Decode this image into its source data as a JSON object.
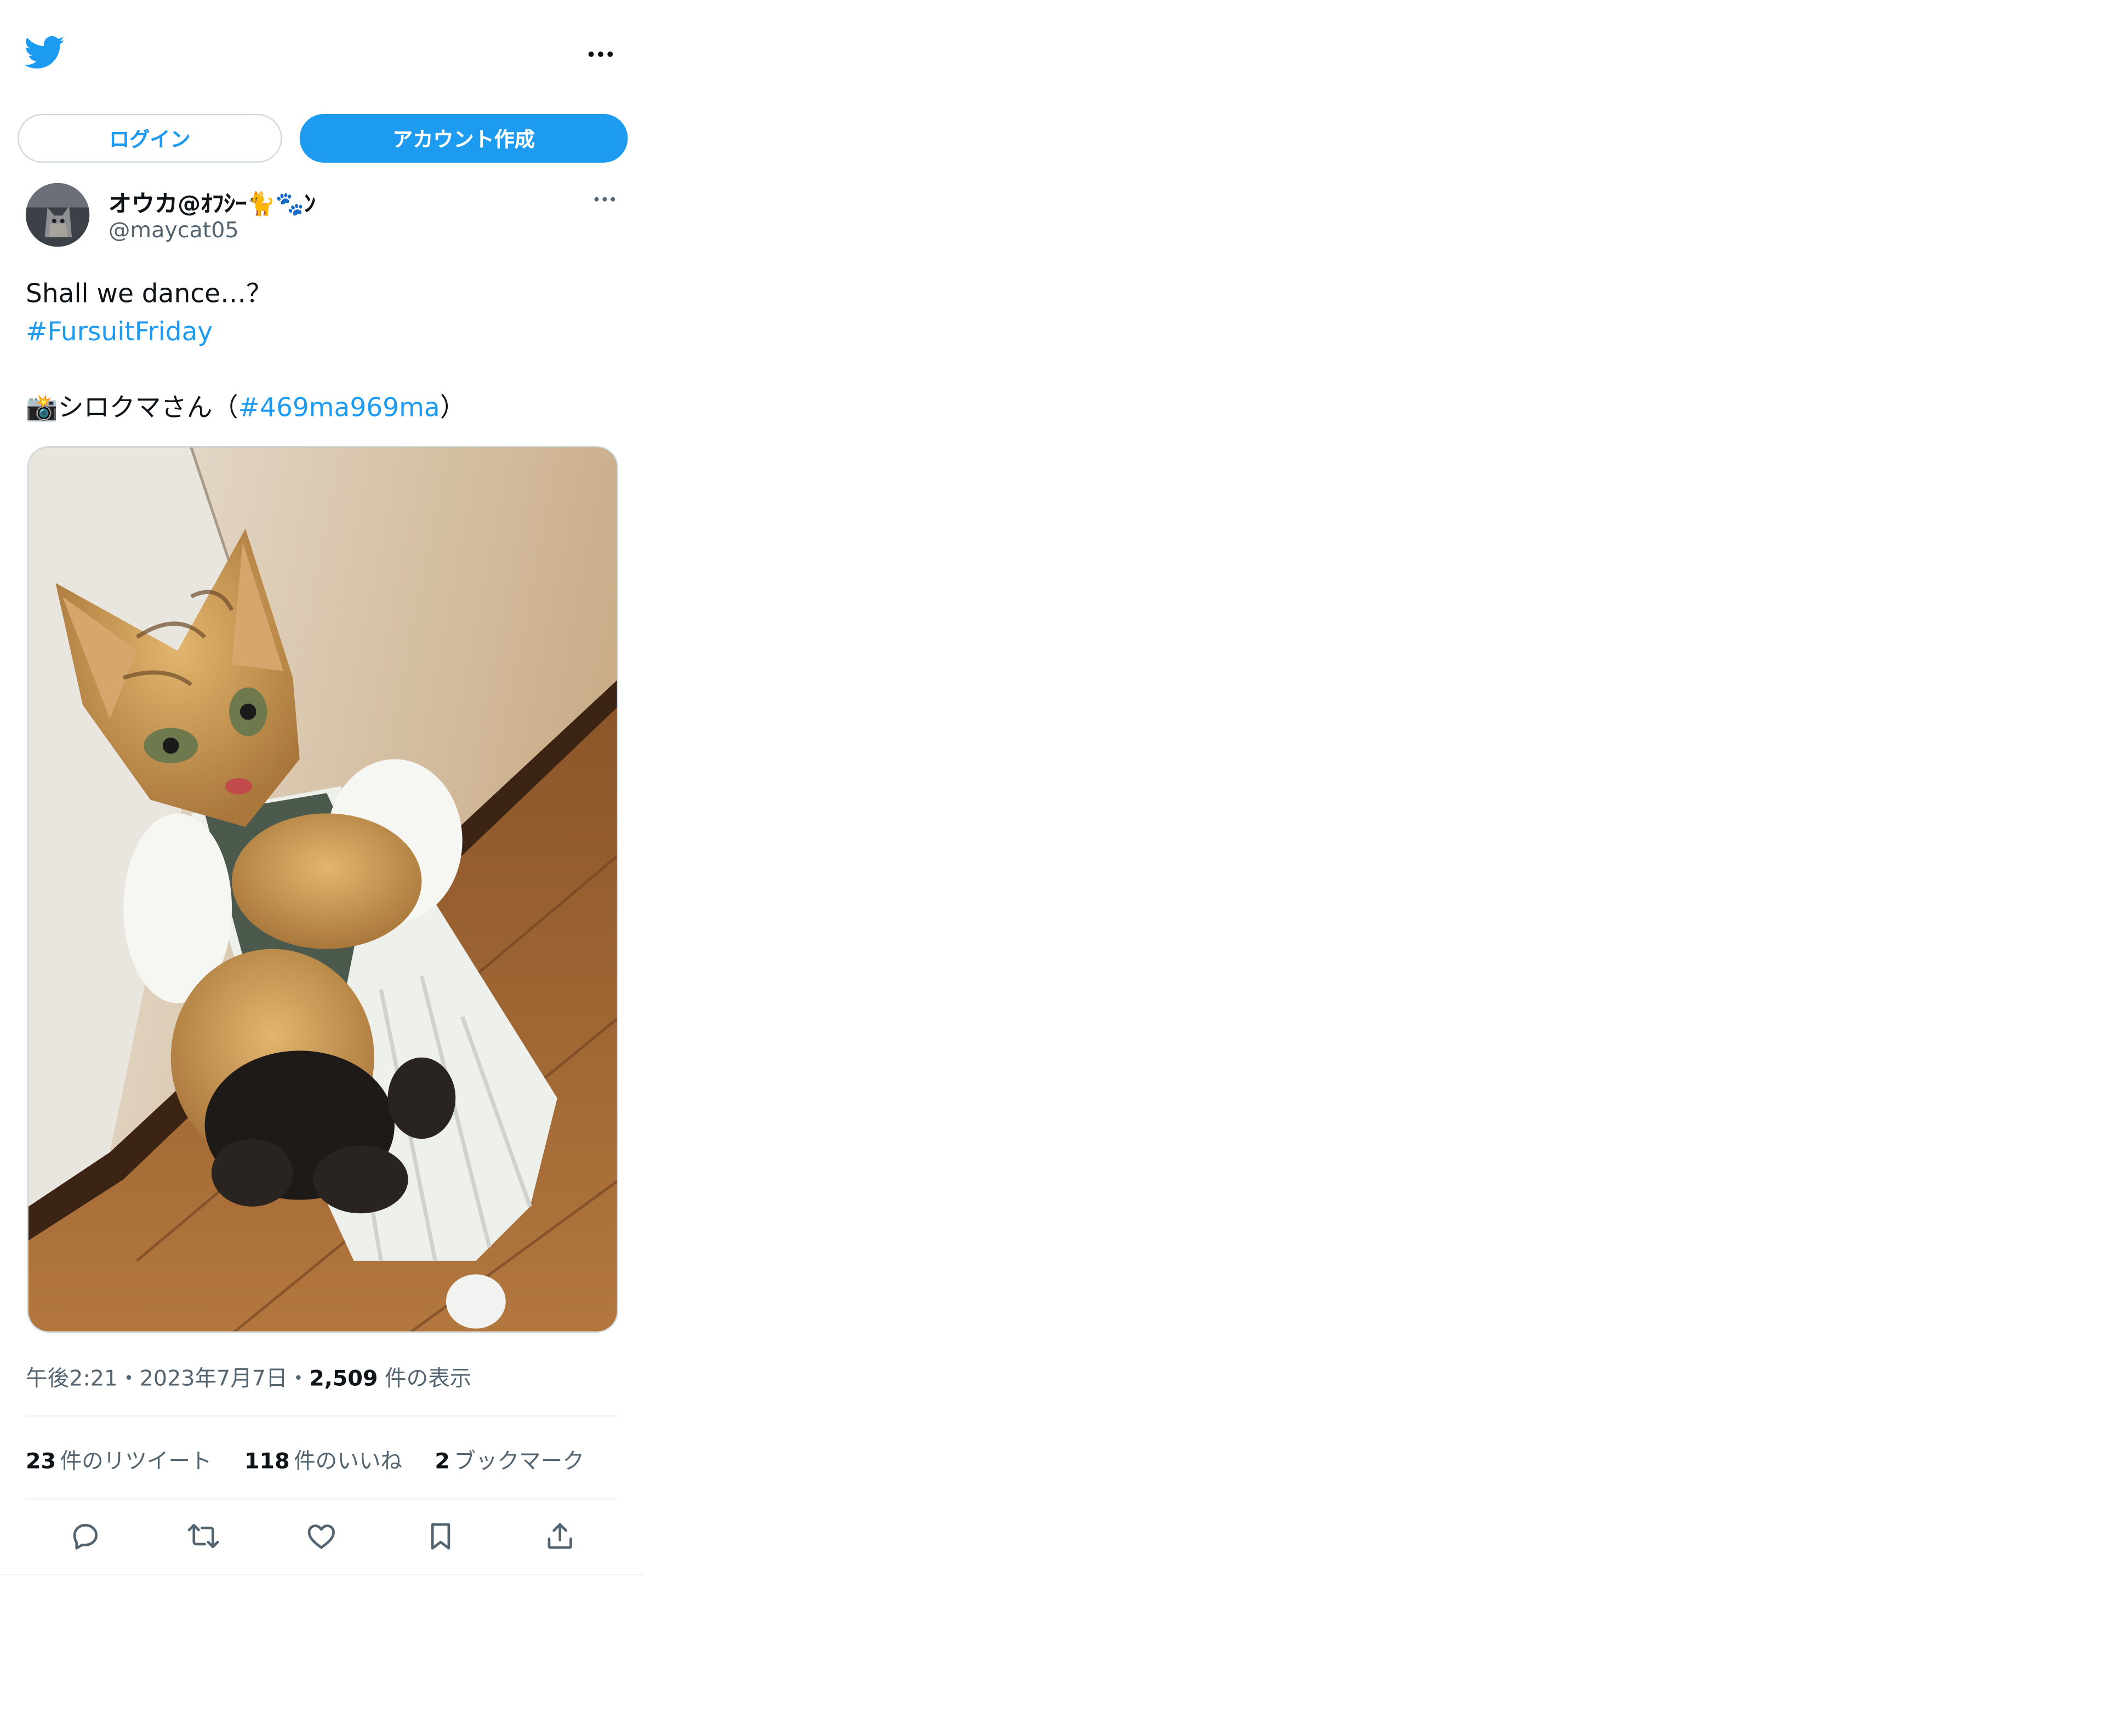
{
  "colors": {
    "accent": "#1d9bf0",
    "text_primary": "#0f1419",
    "text_secondary": "#536471",
    "border": "#cfd9de"
  },
  "header": {
    "logo_icon": "twitter-bird-icon",
    "more_icon": "more-horizontal-icon",
    "login_label": "ログイン",
    "signup_label": "アカウント作成"
  },
  "tweet": {
    "author": {
      "display_name": "オウカ@ｵﾌｼｰ🐈🐾ﾝ",
      "handle": "@maycat05"
    },
    "text": {
      "line1": "Shall we dance…？",
      "hashtag1": "#FursuitFriday",
      "camera_emoji": "📸",
      "line4_prefix": "シロクマさん（",
      "hashtag2": "#469ma969ma",
      "line4_suffix": "）"
    },
    "meta": {
      "time": "午後2:21",
      "sep1": "・",
      "date": "2023年7月7日",
      "sep2": "・",
      "views_count": "2,509",
      "views_label": "件の表示"
    },
    "stats": {
      "retweets_count": "23",
      "retweets_label": "件のリツイート",
      "likes_count": "118",
      "likes_label": "件のいいね",
      "bookmarks_count": "2",
      "bookmarks_label": "ブックマーク"
    },
    "actions": [
      "reply-icon",
      "retweet-icon",
      "like-icon",
      "bookmark-icon",
      "share-icon"
    ]
  }
}
